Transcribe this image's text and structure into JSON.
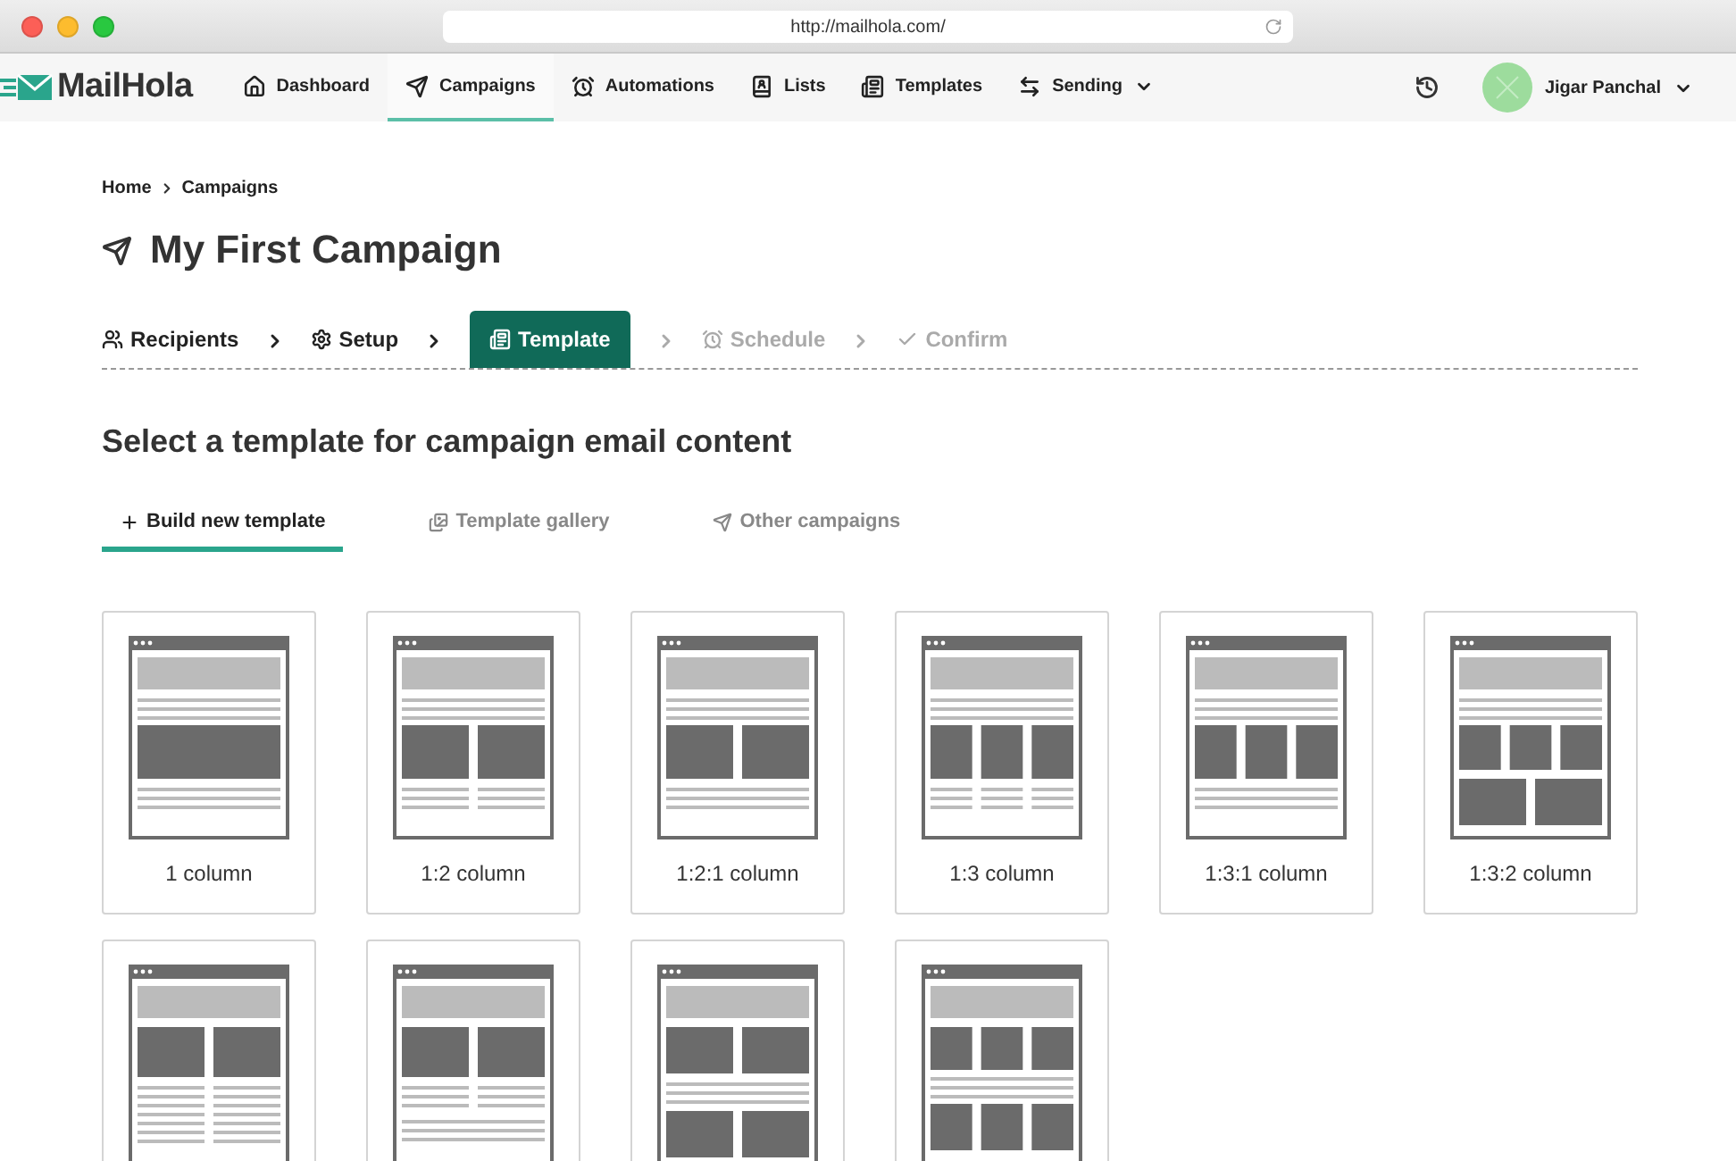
{
  "browser": {
    "url": "http://mailhola.com/"
  },
  "nav": {
    "logo": "MailHola",
    "items": [
      {
        "label": "Dashboard",
        "selected": false,
        "dropdown": false
      },
      {
        "label": "Campaigns",
        "selected": true,
        "dropdown": false
      },
      {
        "label": "Automations",
        "selected": false,
        "dropdown": false
      },
      {
        "label": "Lists",
        "selected": false,
        "dropdown": false
      },
      {
        "label": "Templates",
        "selected": false,
        "dropdown": false
      },
      {
        "label": "Sending",
        "selected": false,
        "dropdown": true
      }
    ],
    "user": {
      "name": "Jigar Panchal"
    }
  },
  "breadcrumb": [
    "Home",
    "Campaigns"
  ],
  "title": "My First Campaign",
  "steps": [
    {
      "label": "Recipients",
      "selected": false,
      "completed": true
    },
    {
      "label": "Setup",
      "selected": false,
      "completed": true
    },
    {
      "label": "Template",
      "selected": true,
      "completed": false
    },
    {
      "label": "Schedule",
      "selected": false,
      "completed": false
    },
    {
      "label": "Confirm",
      "selected": false,
      "completed": false
    }
  ],
  "heading": "Select a template for campaign email content",
  "tabs": [
    {
      "label": "Build new template",
      "selected": true
    },
    {
      "label": "Template gallery",
      "selected": false
    },
    {
      "label": "Other campaigns",
      "selected": false
    }
  ],
  "templates": [
    {
      "label": "1 column",
      "kind": "single"
    },
    {
      "label": "1:2 column",
      "kind": "split"
    },
    {
      "label": "1:2:1 column",
      "kind": "split-band"
    },
    {
      "label": "1:3 column",
      "kind": "triple"
    },
    {
      "label": "1:3:1 column",
      "kind": "triple-band"
    },
    {
      "label": "1:3:2 column",
      "kind": "triple-pair"
    },
    {
      "kind": "split-long"
    },
    {
      "kind": "split-text"
    },
    {
      "kind": "split-stack"
    },
    {
      "kind": "triple-stack"
    }
  ]
}
